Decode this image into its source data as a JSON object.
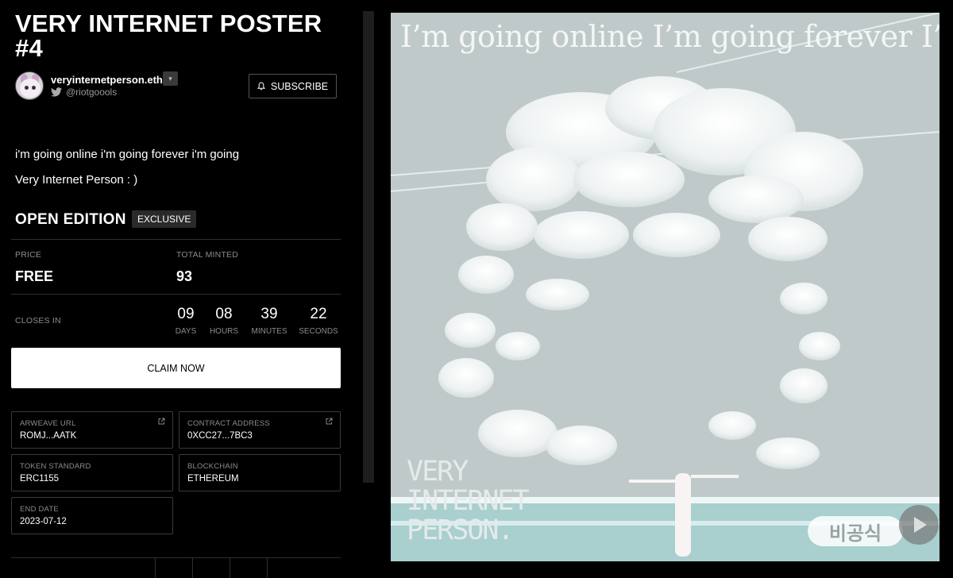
{
  "title": "VERY INTERNET POSTER #4",
  "creator": {
    "name": "veryinternetperson.eth",
    "twitter_handle": "@riotgoools",
    "subscribe_label": "SUBSCRIBE"
  },
  "description": {
    "line1": "i'm going online i'm going forever i'm going",
    "line2": "Very Internet Person : )"
  },
  "edition": {
    "label": "OPEN EDITION",
    "badge": "EXCLUSIVE"
  },
  "stats": {
    "price_label": "PRICE",
    "price_value": "FREE",
    "minted_label": "TOTAL MINTED",
    "minted_value": "93"
  },
  "countdown": {
    "label": "CLOSES IN",
    "days": "09",
    "days_unit": "DAYS",
    "hours": "08",
    "hours_unit": "HOURS",
    "minutes": "39",
    "minutes_unit": "MINUTES",
    "seconds": "22",
    "seconds_unit": "SECONDS"
  },
  "claim_label": "CLAIM NOW",
  "details": {
    "arweave_label": "ARWEAVE URL",
    "arweave_value": "ROMJ...AATK",
    "contract_label": "CONTRACT ADDRESS",
    "contract_value": "0XCC27...7BC3",
    "standard_label": "TOKEN STANDARD",
    "standard_value": "ERC1155",
    "chain_label": "BLOCKCHAIN",
    "chain_value": "ETHEREUM",
    "end_label": "END DATE",
    "end_value": "2023-07-12"
  },
  "artwork": {
    "headline": "I’m going online I’m going forever I’m going",
    "logo_line1": "VERY",
    "logo_line2": "INTERNET",
    "logo_line3": "PERSON.",
    "watermark": "비공식"
  },
  "icons": {
    "dropdown": "chevron-down-icon",
    "twitter": "twitter-icon",
    "bell": "bell-icon",
    "external": "external-link-icon"
  },
  "colors": {
    "background": "#000000",
    "art_sky": "#c0c9ca",
    "claim_button": "#ffffff"
  }
}
